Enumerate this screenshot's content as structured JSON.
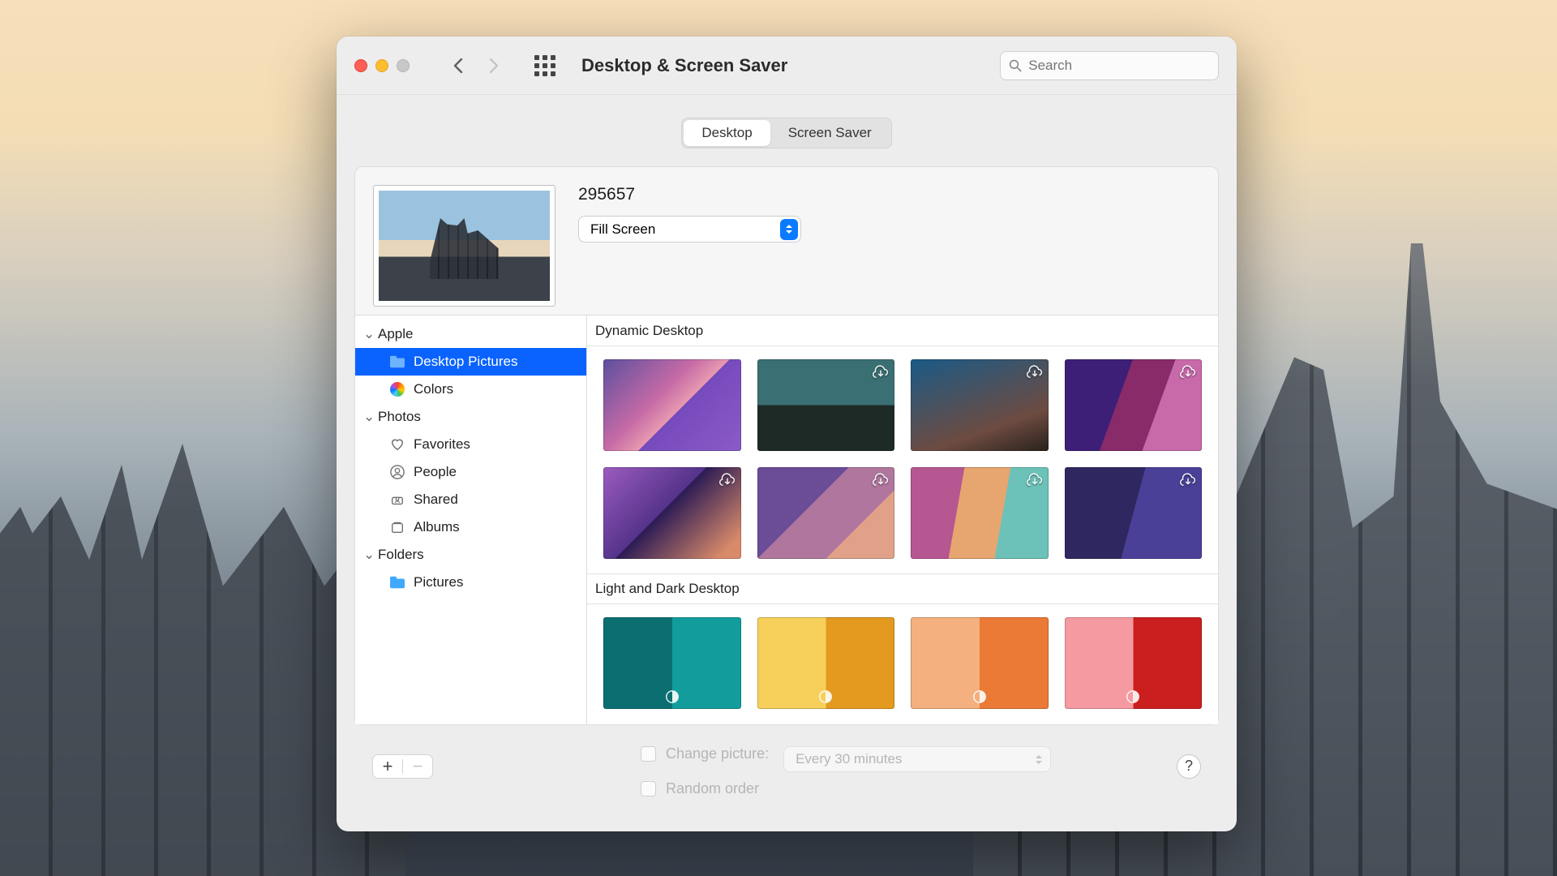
{
  "window_title": "Desktop & Screen Saver",
  "search_placeholder": "Search",
  "tabs": {
    "desktop": "Desktop",
    "screensaver": "Screen Saver",
    "active": "desktop"
  },
  "current_wallpaper_name": "295657",
  "fit_mode": "Fill Screen",
  "sidebar": {
    "apple": {
      "label": "Apple",
      "items": [
        {
          "label": "Desktop Pictures",
          "selected": true
        },
        {
          "label": "Colors",
          "selected": false
        }
      ]
    },
    "photos": {
      "label": "Photos",
      "items": [
        {
          "label": "Favorites"
        },
        {
          "label": "People"
        },
        {
          "label": "Shared"
        },
        {
          "label": "Albums"
        }
      ]
    },
    "folders": {
      "label": "Folders",
      "items": [
        {
          "label": "Pictures"
        }
      ]
    }
  },
  "sections": {
    "dynamic": "Dynamic Desktop",
    "light_dark": "Light and Dark Desktop"
  },
  "options": {
    "change_picture_label": "Change picture:",
    "change_interval": "Every 30 minutes",
    "random_order_label": "Random order"
  },
  "help_symbol": "?"
}
